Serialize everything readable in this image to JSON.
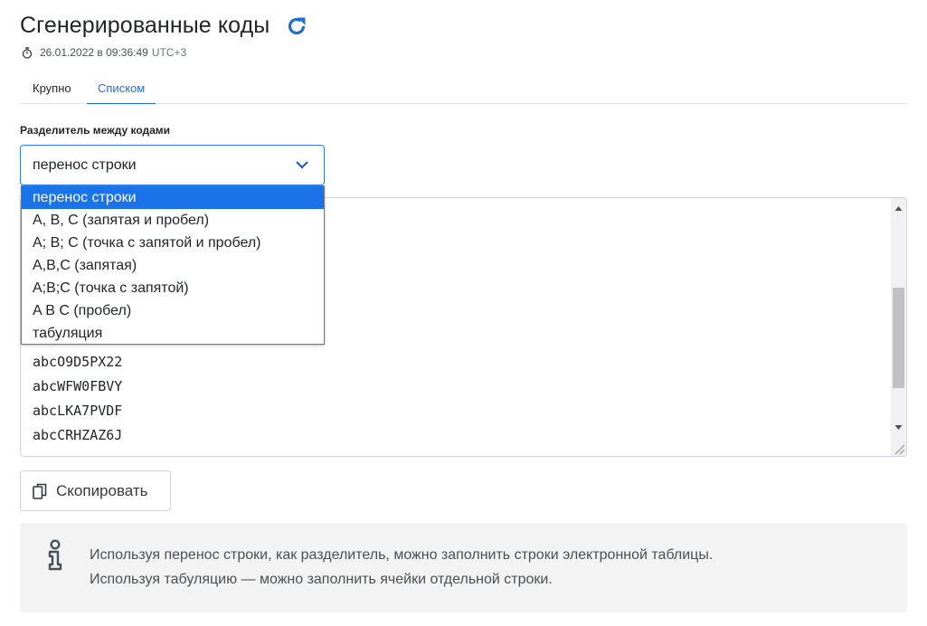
{
  "header": {
    "title": "Сгенерированные коды",
    "timestamp": "26.01.2022 в 09:36:49",
    "timezone": "UTC+3"
  },
  "tabs": [
    {
      "label": "Крупно",
      "active": false
    },
    {
      "label": "Списком",
      "active": true
    }
  ],
  "separator": {
    "label": "Разделитель между кодами",
    "selected": "перенос строки",
    "options": [
      "перенос строки",
      "A, B, C (запятая и пробел)",
      "A; B; C (точка с запятой и пробел)",
      "A,B,C (запятая)",
      "A;B;C (точка с запятой)",
      "A B C (пробел)",
      "табуляция"
    ]
  },
  "codes": [
    "abcO9D5PX22",
    "abcWFW0FBVY",
    "abcLKA7PVDF",
    "abcCRHZAZ6J"
  ],
  "copy_button": {
    "label": "Скопировать"
  },
  "info": {
    "line1": "Используя перенос строки, как разделитель, можно заполнить строки электронной таблицы.",
    "line2": "Используя табуляцию — можно заполнить ячейки отдельной строки."
  },
  "colors": {
    "accent": "#1f6fd1",
    "selected_option": "#1a73e8",
    "info_bg": "#f3f3f3"
  }
}
